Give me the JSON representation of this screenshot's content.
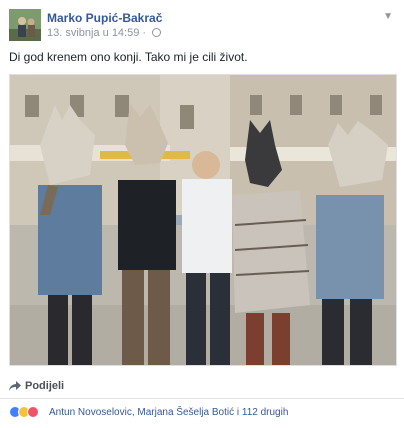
{
  "post": {
    "author": "Marko Pupić-Bakrač",
    "date": "13. svibnja u 14:59 ·",
    "text": "Di god krenem ono konji. Tako mi je cili život.",
    "share_label": "Podijeli",
    "reactions_text": "Antun Novoselovic, Marjana Šešelja Botić i 112 drugih"
  },
  "icons": {
    "audience": "globe-icon",
    "options": "chevron-down-icon",
    "share": "share-arrow-icon",
    "reactions": [
      "like-icon",
      "haha-icon",
      "love-icon"
    ]
  },
  "colors": {
    "author_link": "#365899",
    "meta": "#90949c",
    "like": "#4080ff",
    "haha": "#f5c33b",
    "love": "#f25268"
  }
}
